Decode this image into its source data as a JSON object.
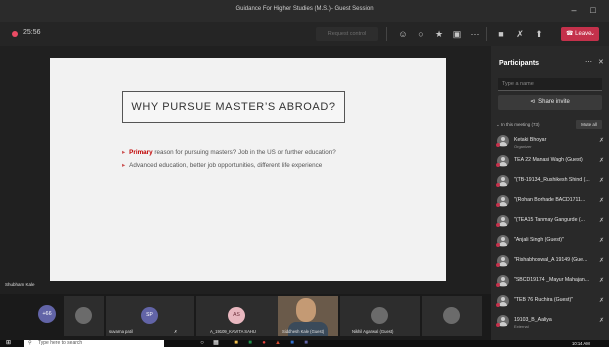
{
  "window": {
    "title": "Guidance For Higher Studies (M.S.)- Guest Session"
  },
  "toolbar": {
    "timer": "25:56",
    "request_control": "Request control",
    "leave_label": "Leave"
  },
  "slide": {
    "title": "WHY PURSUE MASTER’S ABROAD?",
    "bullet1_highlight": "Primary",
    "bullet1_rest": " reason for pursuing masters? Job in the US or further education?",
    "bullet2": "Advanced education, better job opportunities, different life experience"
  },
  "stage": {
    "presenter_name": "Shubham Kale"
  },
  "panel": {
    "title": "Participants",
    "search_placeholder": "Type a name",
    "share_invite": "Share invite",
    "in_meeting": "In this meeting (73)",
    "mute_all": "Mute all",
    "participants": [
      {
        "name": "Ketaki Bhoyar",
        "sub": "Organizer"
      },
      {
        "name": "TEA 22 Manasi Wagh (Guest)",
        "sub": ""
      },
      {
        "name": "\"(TB-19134_Rushikesh Shind (...",
        "sub": ""
      },
      {
        "name": "\"(Rohan Borhade BACD1711...",
        "sub": ""
      },
      {
        "name": "\"(TEA15 Tanmay Gangurde (...",
        "sub": ""
      },
      {
        "name": "\"Anjali Singh (Guest)\"",
        "sub": ""
      },
      {
        "name": "\"Rishabhoswal_A 19149 (Gue...",
        "sub": ""
      },
      {
        "name": "\"SBCD19174 _Mayur Mahajan...",
        "sub": ""
      },
      {
        "name": "\"TEB 76 Ruchira (Guest)\"",
        "sub": ""
      },
      {
        "name": "19103_B_Aaliya",
        "sub": "External"
      }
    ]
  },
  "strip": {
    "more_count": "+66",
    "tiles": [
      {
        "initials": "SP",
        "label": "suvarna patil"
      },
      {
        "initials": "AS",
        "label": "A_19109_KAVITA SAHU"
      },
      {
        "initials": "",
        "label": "Siddhesh Kale (Guest)"
      },
      {
        "initials": "",
        "label": "Nikhil Agarwal (Guest)"
      }
    ]
  },
  "taskbar": {
    "search_placeholder": "Type here to search",
    "time": "10:14 AM"
  },
  "colors": {
    "accent": "#6264a7",
    "leave": "#c4314b",
    "highlight": "#c00000"
  }
}
